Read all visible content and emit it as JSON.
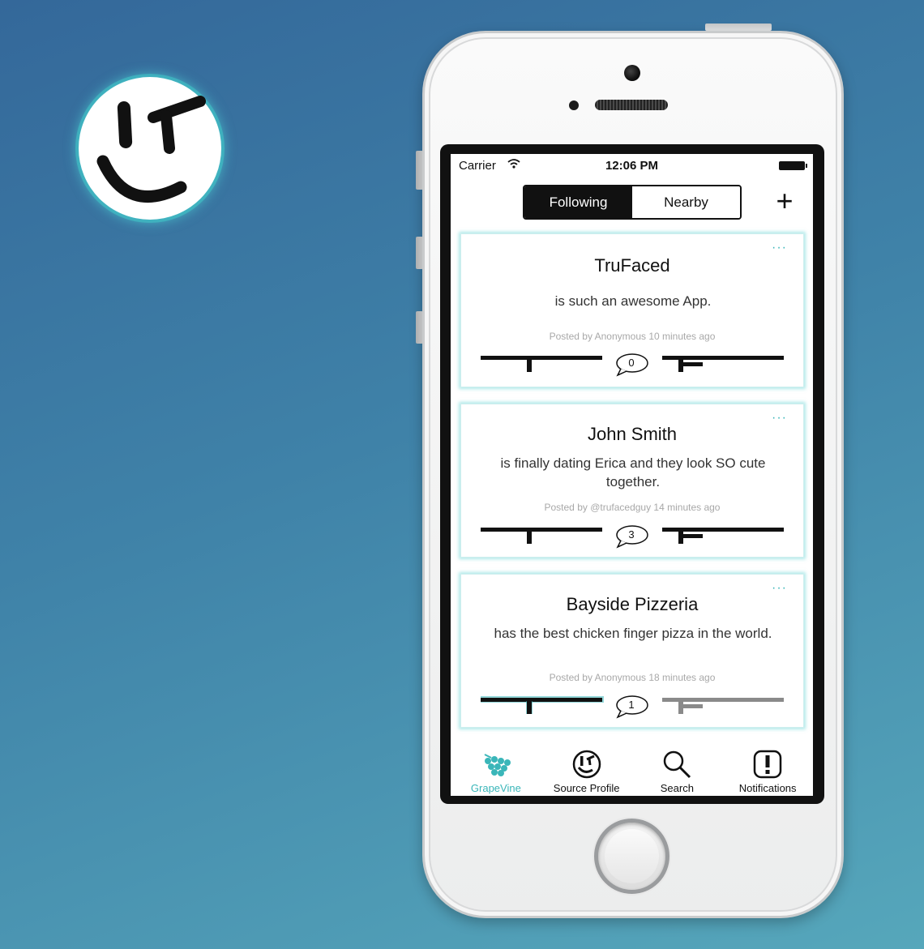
{
  "status_bar": {
    "carrier": "Carrier",
    "time": "12:06 PM"
  },
  "segmented": {
    "following": "Following",
    "nearby": "Nearby",
    "selected": "Following"
  },
  "posts": [
    {
      "name": "TruFaced",
      "text": "is such an awesome App.",
      "meta": "Posted by Anonymous 10 minutes ago",
      "comments": "0"
    },
    {
      "name": "John Smith",
      "text": "is finally dating Erica and they look SO cute together.",
      "meta": "Posted by @trufacedguy 14 minutes ago",
      "comments": "3"
    },
    {
      "name": "Bayside Pizzeria",
      "text": "has the best chicken finger pizza in the world.",
      "meta": "Posted by Anonymous 18 minutes ago",
      "comments": "1"
    }
  ],
  "tabs": [
    {
      "label": "GrapeVine",
      "icon": "grapes-icon",
      "active": true
    },
    {
      "label": "Source Profile",
      "icon": "smiley-icon",
      "active": false
    },
    {
      "label": "Search",
      "icon": "search-icon",
      "active": false
    },
    {
      "label": "Notifications",
      "icon": "exclamation-icon",
      "active": false
    }
  ],
  "colors": {
    "accent": "#3ab6b9",
    "background_top": "#34689a",
    "background_bottom": "#56a7bb"
  }
}
